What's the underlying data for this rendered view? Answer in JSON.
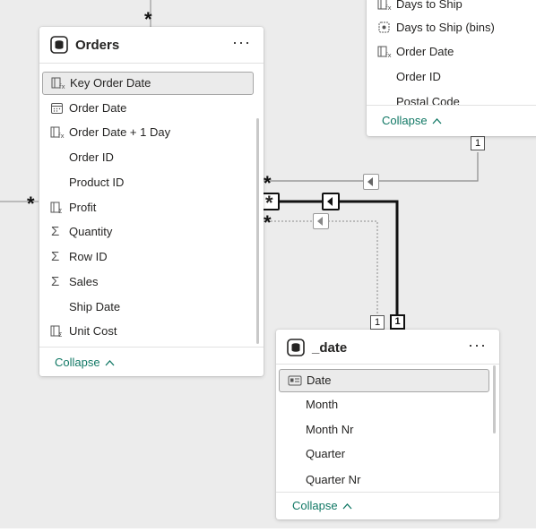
{
  "orders": {
    "title": "Orders",
    "more": "···",
    "collapse": "Collapse",
    "fields": [
      {
        "label": "Key Order Date",
        "icon": "calculated-column-icon",
        "selected": true
      },
      {
        "label": "Order Date",
        "icon": "calendar-icon"
      },
      {
        "label": "Order Date + 1 Day",
        "icon": "calculated-column-icon"
      },
      {
        "label": "Order ID",
        "icon": ""
      },
      {
        "label": "Product ID",
        "icon": ""
      },
      {
        "label": "Profit",
        "icon": "calculated-column-icon"
      },
      {
        "label": "Quantity",
        "icon": "sigma-icon"
      },
      {
        "label": "Row ID",
        "icon": "sigma-icon"
      },
      {
        "label": "Sales",
        "icon": "sigma-icon"
      },
      {
        "label": "Ship Date",
        "icon": ""
      },
      {
        "label": "Unit Cost",
        "icon": "calculated-column-icon"
      }
    ]
  },
  "date_table": {
    "title": "_date",
    "more": "···",
    "collapse": "Collapse",
    "fields": [
      {
        "label": "Date",
        "icon": "id-card-icon",
        "selected": true
      },
      {
        "label": "Month",
        "icon": ""
      },
      {
        "label": "Month Nr",
        "icon": ""
      },
      {
        "label": "Quarter",
        "icon": ""
      },
      {
        "label": "Quarter Nr",
        "icon": ""
      }
    ]
  },
  "top_right": {
    "collapse": "Collapse",
    "fields": [
      {
        "label": "Days to Ship",
        "icon": "calculated-column-icon"
      },
      {
        "label": "Days to Ship (bins)",
        "icon": "bins-icon"
      },
      {
        "label": "Order Date",
        "icon": "calculated-column-icon"
      },
      {
        "label": "Order ID",
        "icon": ""
      },
      {
        "label": "Postal Code",
        "icon": ""
      }
    ]
  },
  "relationships": {
    "many": "*",
    "one": "1"
  }
}
